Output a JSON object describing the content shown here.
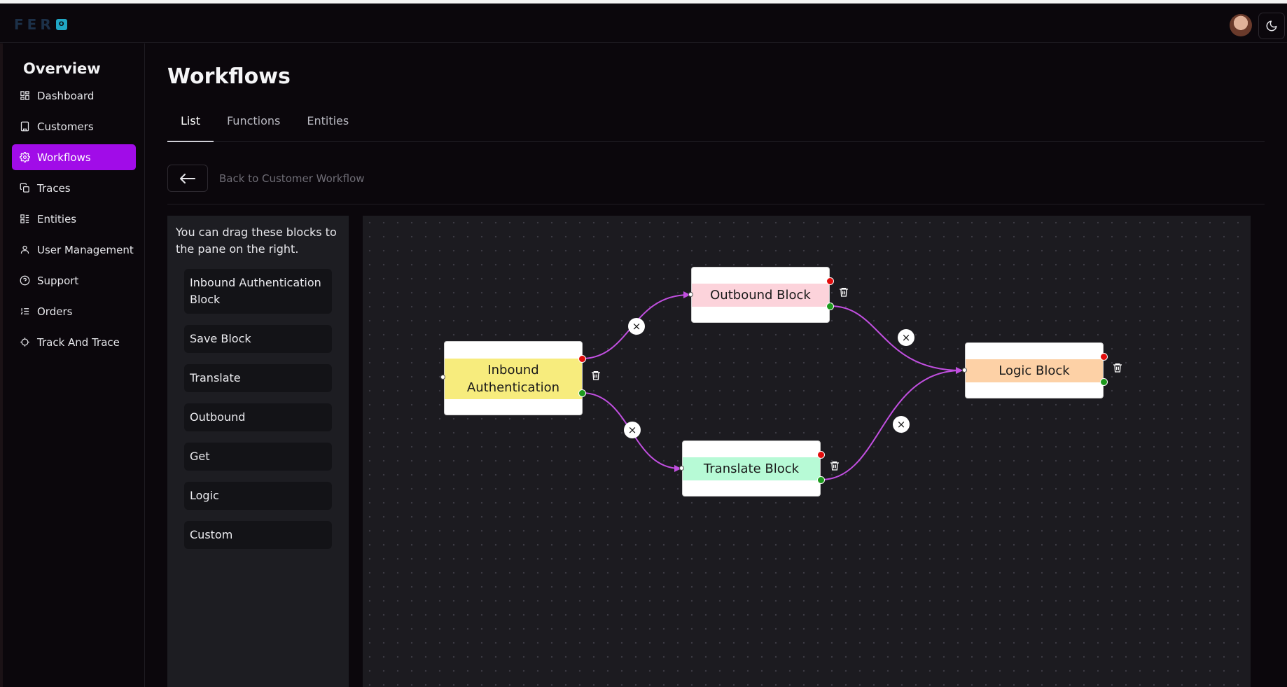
{
  "app": {
    "logo_text": "FER",
    "logo_badge": "O"
  },
  "sidebar": {
    "title": "Overview",
    "items": [
      {
        "label": "Dashboard",
        "icon": "dashboard-icon"
      },
      {
        "label": "Customers",
        "icon": "building-icon"
      },
      {
        "label": "Workflows",
        "icon": "gear-icon",
        "active": true
      },
      {
        "label": "Traces",
        "icon": "copy-icon"
      },
      {
        "label": "Entities",
        "icon": "list-icon"
      },
      {
        "label": "User Management",
        "icon": "user-icon"
      },
      {
        "label": "Support",
        "icon": "help-circle-icon"
      },
      {
        "label": "Orders",
        "icon": "ordered-list-icon"
      },
      {
        "label": "Track And Trace",
        "icon": "crosshair-icon"
      }
    ]
  },
  "page": {
    "title": "Workflows"
  },
  "tabs": [
    {
      "label": "List",
      "active": true
    },
    {
      "label": "Functions"
    },
    {
      "label": "Entities"
    }
  ],
  "back": {
    "label": "Back to Customer Workflow"
  },
  "palette": {
    "hint": "You can drag these blocks to the pane on the right.",
    "items": [
      "Inbound Authentication Block",
      "Save Block",
      "Translate",
      "Outbound",
      "Get",
      "Logic",
      "Custom"
    ]
  },
  "flow": {
    "edge_color": "#c14fe0",
    "nodes": [
      {
        "id": "inbound",
        "label": "Inbound Authentication",
        "color": "#f7ec7d"
      },
      {
        "id": "outbound",
        "label": "Outbound Block",
        "color": "#fcd3db"
      },
      {
        "id": "translate",
        "label": "Translate Block",
        "color": "#b7fad6"
      },
      {
        "id": "logic",
        "label": "Logic Block",
        "color": "#fdd1a6"
      }
    ],
    "edges": [
      {
        "from": "inbound",
        "to": "outbound"
      },
      {
        "from": "inbound",
        "to": "translate"
      },
      {
        "from": "outbound",
        "to": "logic"
      },
      {
        "from": "translate",
        "to": "logic"
      }
    ],
    "delete_edge_symbol": "×"
  }
}
